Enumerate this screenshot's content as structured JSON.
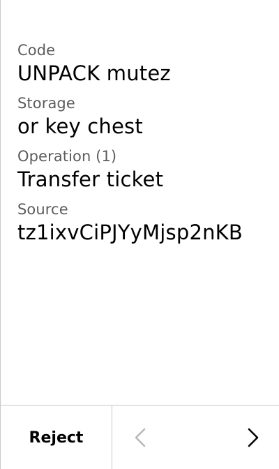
{
  "fields": [
    {
      "label": "Code",
      "value": "UNPACK mutez"
    },
    {
      "label": "Storage",
      "value": "or key chest"
    },
    {
      "label": "Operation (1)",
      "value": "Transfer ticket"
    },
    {
      "label": "Source",
      "value": "tz1ixvCiPJYyMjsp2nKB"
    }
  ],
  "footer": {
    "reject_label": "Reject",
    "prev_icon": "chevron-left-icon",
    "next_icon": "chevron-right-icon",
    "prev_color": "#b8b8b8",
    "next_color": "#000000"
  }
}
